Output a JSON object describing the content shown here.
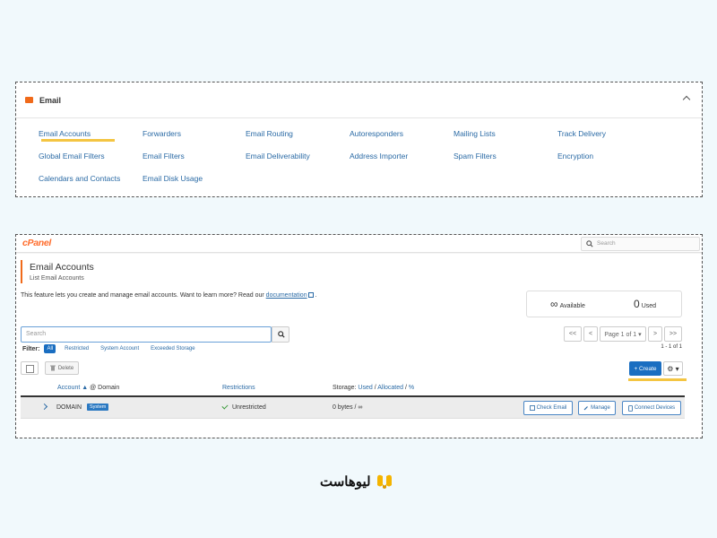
{
  "email_panel": {
    "title": "Email",
    "links": [
      "Email Accounts",
      "Forwarders",
      "Email Routing",
      "Autoresponders",
      "Mailing Lists",
      "Track Delivery",
      "Global Email Filters",
      "Email Filters",
      "Email Deliverability",
      "Address Importer",
      "Spam Filters",
      "Encryption",
      "Calendars and Contacts",
      "Email Disk Usage"
    ]
  },
  "cpanel": {
    "logo": "cPanel",
    "search_placeholder": "Search",
    "page_title": "Email Accounts",
    "page_subtitle": "List Email Accounts",
    "description": "This feature lets you create and manage email accounts. Want to learn more? Read our",
    "doc_link": "documentation",
    "desc_end": ".",
    "stats": {
      "available_value": "∞",
      "available_label": "Available",
      "used_value": "0",
      "used_label": "Used"
    },
    "list_search_placeholder": "Search",
    "pager": {
      "first": "<<",
      "prev": "<",
      "page": "Page 1 of 1 ▾",
      "next": ">",
      "last": ">>"
    },
    "range": "1 - 1 of 1",
    "filter": {
      "label": "Filter:",
      "options": [
        "All",
        "Restricted",
        "System Account",
        "Exceeded Storage"
      ],
      "active": "All"
    },
    "delete_label": "Delete",
    "create_label": "+ Create",
    "gear_label": "⚙ ▾",
    "columns": {
      "account": "Account ▲",
      "at_domain": "@ Domain",
      "restrictions": "Restrictions",
      "storage_prefix": "Storage:",
      "used": "Used",
      "sep1": "/",
      "allocated": "Allocated",
      "sep2": "/",
      "percent": "%"
    },
    "row": {
      "account": "DOMAIN",
      "badge": "System",
      "restriction": "Unrestricted",
      "storage": "0 bytes / ∞",
      "actions": [
        "Check Email",
        "Manage",
        "Connect Devices"
      ]
    },
    "accent_color": "#f06a1a",
    "primary_color": "#1a6ec1"
  },
  "brand": {
    "name": "لیوهاست",
    "color": "#f4b400"
  }
}
